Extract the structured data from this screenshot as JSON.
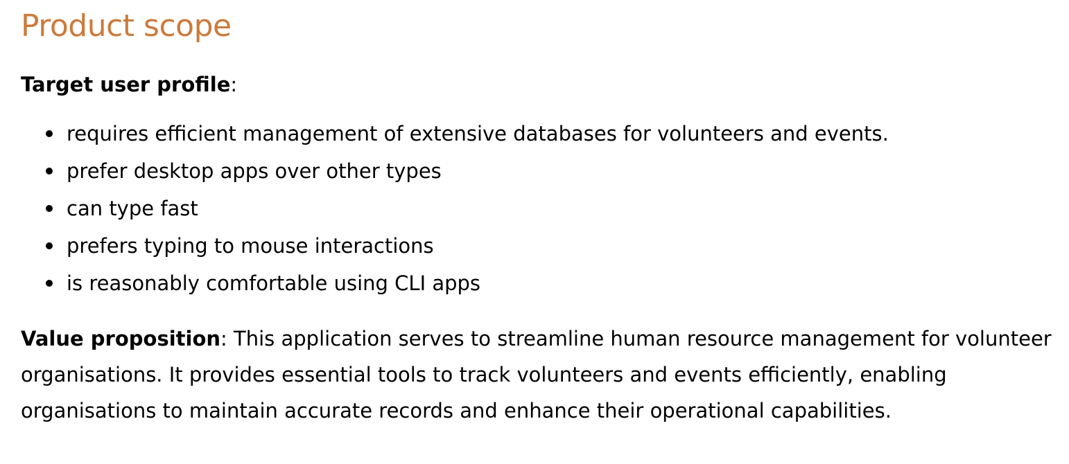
{
  "section": {
    "title": "Product scope"
  },
  "target_user_profile": {
    "label": "Target user profile",
    "suffix": ":",
    "items": [
      "requires efficient management of extensive databases for volunteers and events.",
      "prefer desktop apps over other types",
      "can type fast",
      "prefers typing to mouse interactions",
      "is reasonably comfortable using CLI apps"
    ]
  },
  "value_proposition": {
    "label": "Value proposition",
    "text": ": This application serves to streamline human resource management for volunteer organisations. It provides essential tools to track volunteers and events efficiently, enabling organisations to maintain accurate records and enhance their operational capabilities."
  },
  "colors": {
    "heading": "#cc7a3b",
    "text": "#000000",
    "background": "#ffffff"
  }
}
